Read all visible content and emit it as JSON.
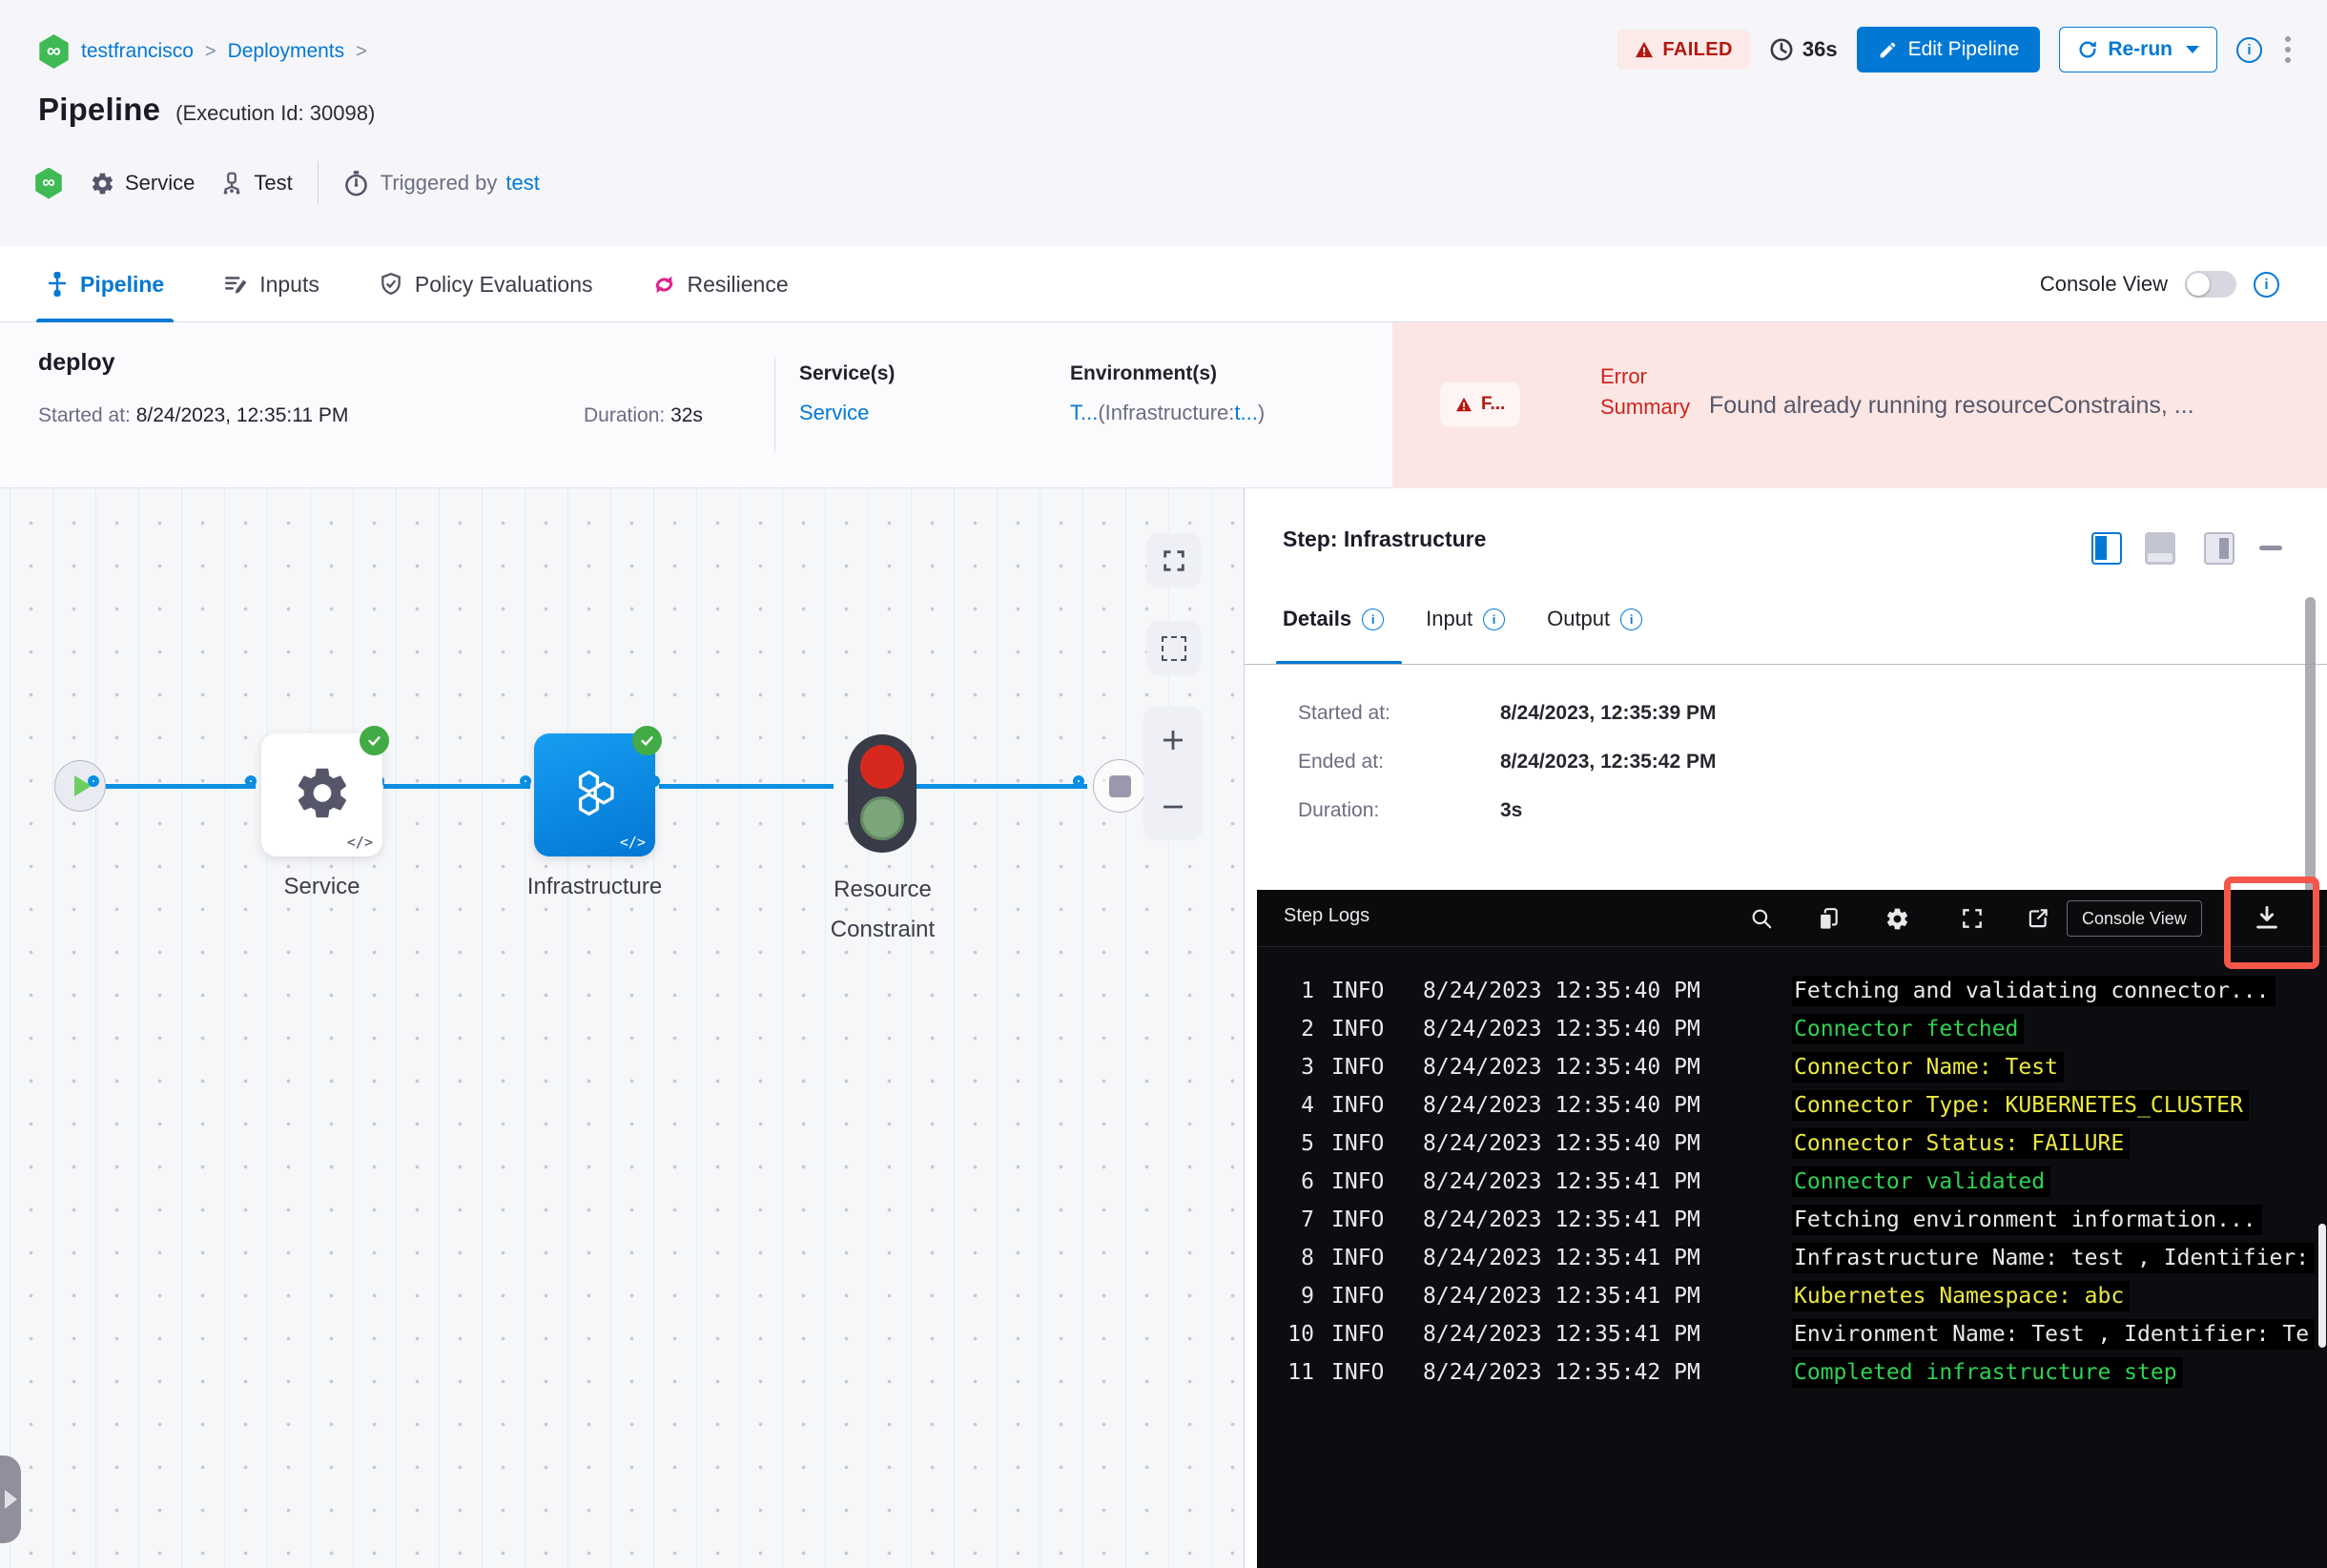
{
  "breadcrumb": {
    "project": "testfrancisco",
    "separator": ">",
    "section": "Deployments"
  },
  "header": {
    "title": "Pipeline",
    "execution_id": "(Execution Id: 30098)",
    "status": "FAILED",
    "duration": "36s",
    "edit_button": "Edit Pipeline",
    "rerun_button": "Re-run",
    "service_label": "Service",
    "test_label": "Test",
    "triggered_by_label": "Triggered by",
    "triggered_by_value": "test"
  },
  "tabs": {
    "pipeline": "Pipeline",
    "inputs": "Inputs",
    "policy_evaluations": "Policy Evaluations",
    "resilience": "Resilience",
    "console_view_label": "Console View"
  },
  "summary": {
    "stage_name": "deploy",
    "started_label": "Started at:",
    "started_value": "8/24/2023, 12:35:11 PM",
    "duration_label": "Duration:",
    "duration_value": "32s",
    "services_label": "Service(s)",
    "services_value": "Service",
    "environments_label": "Environment(s)",
    "env_link1": "T...",
    "env_mid": "(Infrastructure:",
    "env_link2": "t...",
    "env_close": ")",
    "failed_chip": "F...",
    "error_label": "Error Summary",
    "error_message": "Found already running resourceConstrains, ..."
  },
  "graph": {
    "service_label": "Service",
    "infrastructure_label": "Infrastructure",
    "resource_constraint_label": "Resource Constraint",
    "code_glyph": "</>"
  },
  "step_panel": {
    "title": "Step: Infrastructure",
    "details_tab": "Details",
    "input_tab": "Input",
    "output_tab": "Output",
    "meta": [
      {
        "label": "Started at:",
        "value": "8/24/2023, 12:35:39 PM"
      },
      {
        "label": "Ended at:",
        "value": "8/24/2023, 12:35:42 PM"
      },
      {
        "label": "Duration:",
        "value": "3s"
      }
    ]
  },
  "logs": {
    "title": "Step Logs",
    "console_view_button": "Console View",
    "rows": [
      {
        "num": "1",
        "level": "INFO",
        "time": "8/24/2023 12:35:40 PM",
        "msg": "Fetching and validating connector...",
        "color": "white"
      },
      {
        "num": "2",
        "level": "INFO",
        "time": "8/24/2023 12:35:40 PM",
        "msg": "Connector fetched",
        "color": "green"
      },
      {
        "num": "3",
        "level": "INFO",
        "time": "8/24/2023 12:35:40 PM",
        "msg": "Connector Name: Test",
        "color": "yellow"
      },
      {
        "num": "4",
        "level": "INFO",
        "time": "8/24/2023 12:35:40 PM",
        "msg": "Connector Type: KUBERNETES_CLUSTER",
        "color": "yellow"
      },
      {
        "num": "5",
        "level": "INFO",
        "time": "8/24/2023 12:35:40 PM",
        "msg": "Connector Status: FAILURE",
        "color": "yellow"
      },
      {
        "num": "6",
        "level": "INFO",
        "time": "8/24/2023 12:35:41 PM",
        "msg": "Connector validated",
        "color": "green"
      },
      {
        "num": "7",
        "level": "INFO",
        "time": "8/24/2023 12:35:41 PM",
        "msg": "Fetching environment information...",
        "color": "white"
      },
      {
        "num": "8",
        "level": "INFO",
        "time": "8/24/2023 12:35:41 PM",
        "msg": "Infrastructure Name: test , Identifier:",
        "color": "white"
      },
      {
        "num": "9",
        "level": "INFO",
        "time": "8/24/2023 12:35:41 PM",
        "msg": "Kubernetes Namespace: abc",
        "color": "yellow"
      },
      {
        "num": "10",
        "level": "INFO",
        "time": "8/24/2023 12:35:41 PM",
        "msg": "Environment Name: Test , Identifier: Te",
        "color": "white"
      },
      {
        "num": "11",
        "level": "INFO",
        "time": "8/24/2023 12:35:42 PM",
        "msg": "Completed infrastructure step",
        "color": "green"
      }
    ]
  },
  "colors": {
    "primary": "#0278D5",
    "failed_red": "#B41710",
    "error_bg": "#FBE6E4",
    "success_green": "#42AB45",
    "node_blue": "#0B8EE3",
    "log_green": "#2ED253",
    "log_yellow": "#ECE93E",
    "highlight_red": "#F4564A",
    "error_text": "#CF231C"
  }
}
